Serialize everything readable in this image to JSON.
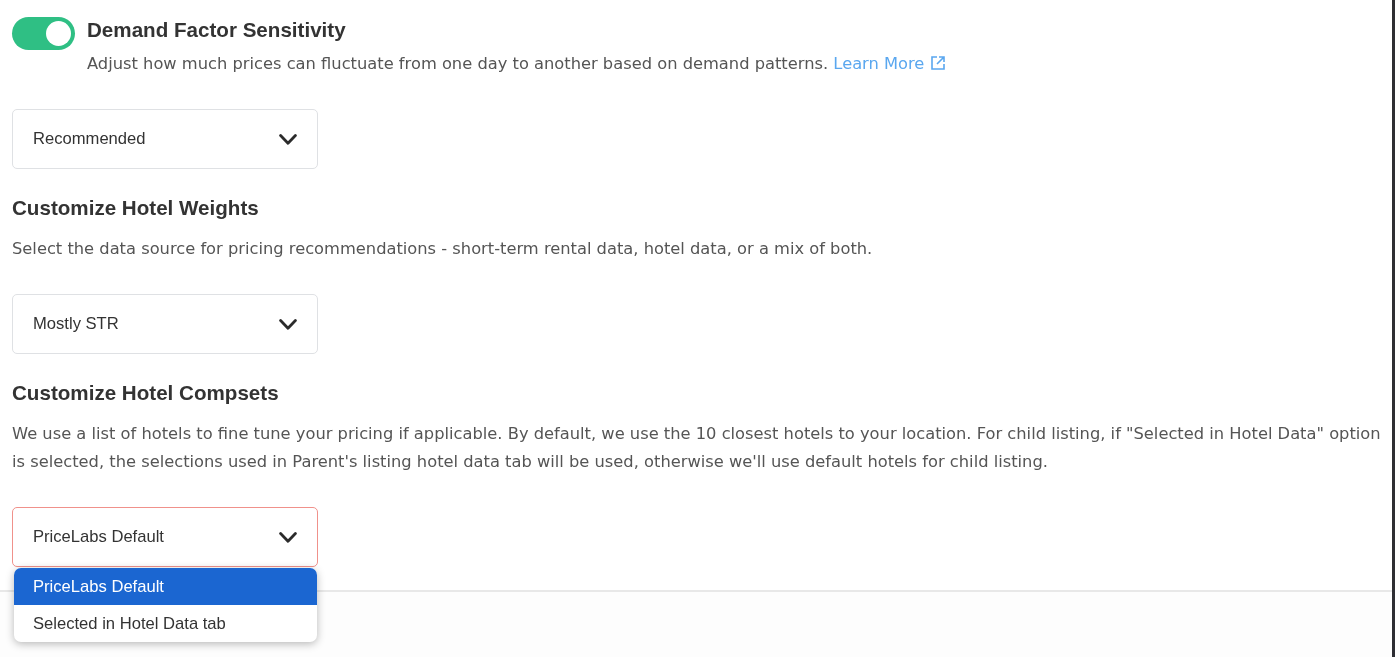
{
  "sections": [
    {
      "toggle": {
        "on": true
      },
      "title": "Demand Factor Sensitivity",
      "description": "Adjust how much prices can fluctuate from one day to another based on demand patterns.",
      "link": "Learn More",
      "select": {
        "value": "Recommended",
        "focused": false
      }
    },
    {
      "title": "Customize Hotel Weights",
      "description": "Select the data source for pricing recommendations - short-term rental data, hotel data, or a mix of both.",
      "select": {
        "value": "Mostly STR",
        "focused": false
      }
    },
    {
      "title": "Customize Hotel Compsets",
      "description": "We use a list of hotels to fine tune your pricing if applicable. By default, we use the 10 closest hotels to your location. For child listing, if \"Selected in Hotel Data\" option is selected, the selections used in Parent's listing hotel data tab will be used, otherwise we'll use default hotels for child listing.",
      "select": {
        "value": "PriceLabs Default",
        "focused": true,
        "expanded": true,
        "options": [
          {
            "label": "PriceLabs Default",
            "selected": true
          },
          {
            "label": "Selected in Hotel Data tab",
            "selected": false
          }
        ]
      }
    }
  ]
}
